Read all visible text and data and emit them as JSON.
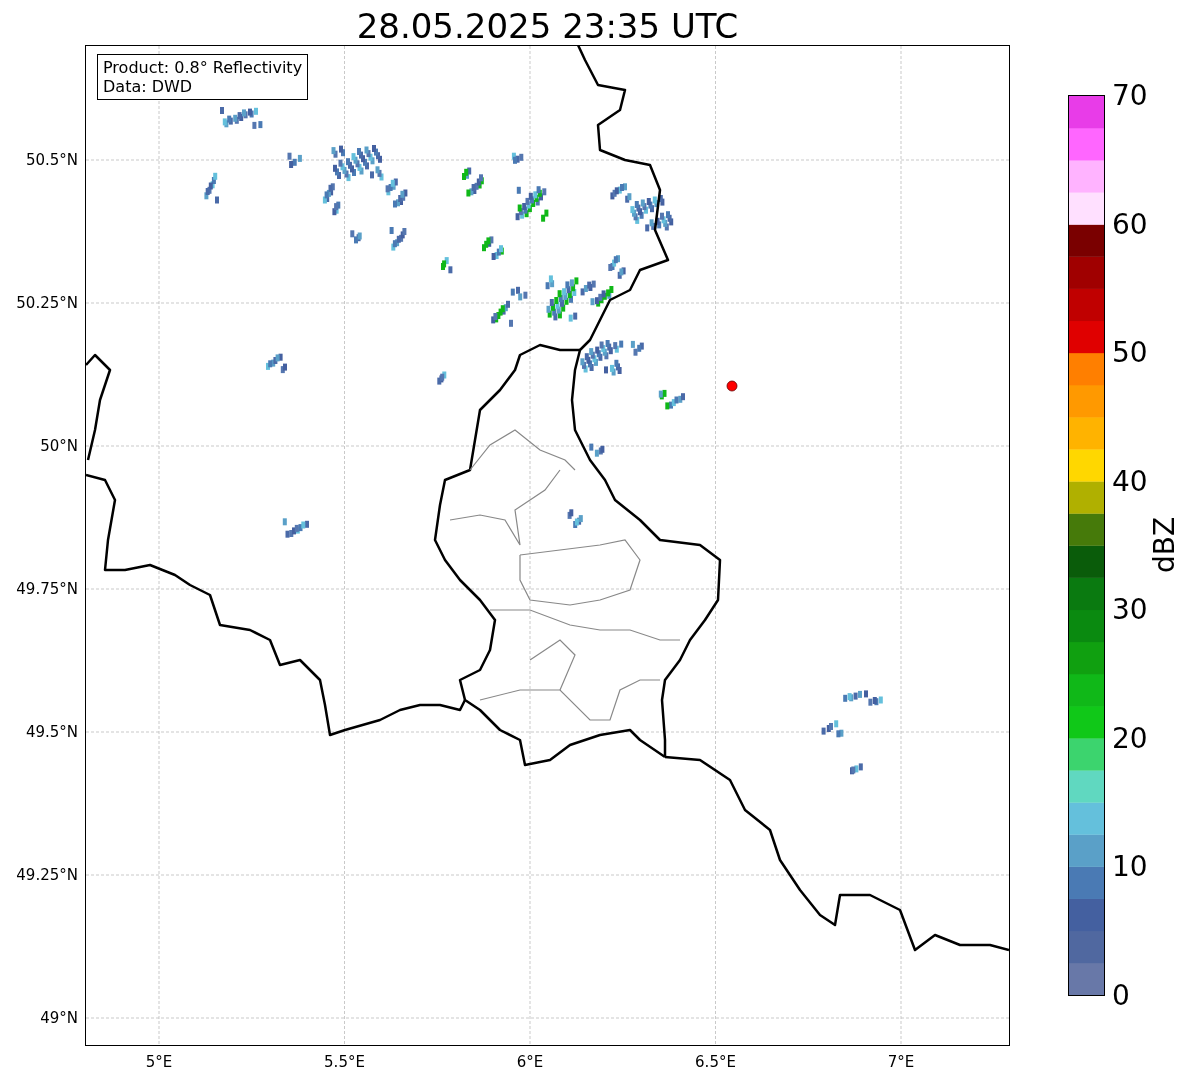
{
  "title": "28.05.2025 23:35 UTC",
  "info_box": [
    "Product: 0.8° Reflectivity",
    "Data: DWD"
  ],
  "map": {
    "y_ticks": [
      "50.5°N",
      "50.25°N",
      "50°N",
      "49.75°N",
      "49.5°N",
      "49.25°N",
      "49°N"
    ],
    "x_ticks": [
      "5°E",
      "5.5°E",
      "6°E",
      "6.5°E",
      "7°E"
    ]
  },
  "colorbar": {
    "label": "dBZ",
    "ticks": [
      "70",
      "60",
      "50",
      "40",
      "30",
      "20",
      "10",
      "0"
    ],
    "bands": [
      {
        "color": "#6878a8"
      },
      {
        "color": "#5068a0"
      },
      {
        "color": "#4460a0"
      },
      {
        "color": "#4a7ab4"
      },
      {
        "color": "#5aa0c8"
      },
      {
        "color": "#64c0dc"
      },
      {
        "color": "#60d8c0"
      },
      {
        "color": "#3cd46e"
      },
      {
        "color": "#10c818"
      },
      {
        "color": "#10b818"
      },
      {
        "color": "#10a010"
      },
      {
        "color": "#0a8a10"
      },
      {
        "color": "#0a7a10"
      },
      {
        "color": "#0a5c0a"
      },
      {
        "color": "#467a0a"
      },
      {
        "color": "#b0b000"
      },
      {
        "color": "#ffd700"
      },
      {
        "color": "#ffb300"
      },
      {
        "color": "#ff9900"
      },
      {
        "color": "#ff7f00"
      },
      {
        "color": "#e00000"
      },
      {
        "color": "#c00000"
      },
      {
        "color": "#a00000"
      },
      {
        "color": "#7a0000"
      },
      {
        "color": "#ffe0ff"
      },
      {
        "color": "#ffb3ff"
      },
      {
        "color": "#ff66ff"
      },
      {
        "color": "#e83ce8"
      }
    ]
  }
}
